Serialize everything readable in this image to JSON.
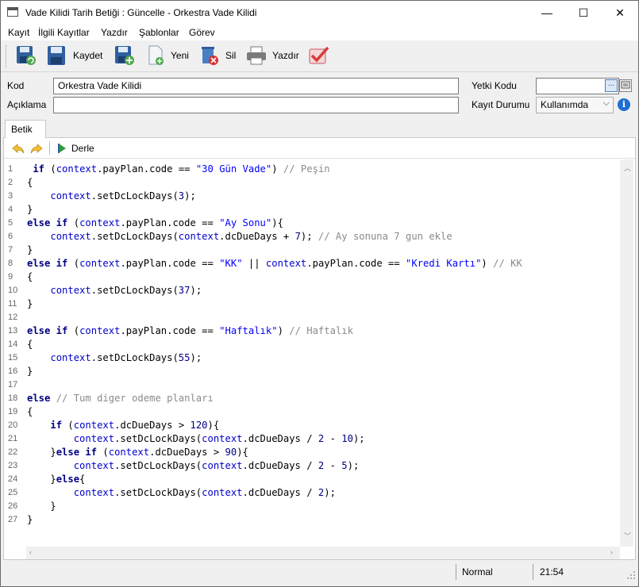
{
  "window": {
    "title": "Vade Kilidi Tarih Betiği : Güncelle - Orkestra Vade Kilidi",
    "minimize_glyph": "—",
    "maximize_glyph": "☐",
    "close_glyph": "✕"
  },
  "menu": [
    "Kayıt",
    "İlgili Kayıtlar",
    "Yazdır",
    "Şablonlar",
    "Görev"
  ],
  "toolbar": {
    "save_label": "Kaydet",
    "new_label": "Yeni",
    "delete_label": "Sil",
    "print_label": "Yazdır",
    "icons": [
      "save-reload-icon",
      "save-icon",
      "save-new-icon",
      "new-document-icon",
      "delete-icon",
      "printer-icon",
      "check-icon"
    ]
  },
  "form": {
    "code_label": "Kod",
    "code_value": "Orkestra Vade Kilidi",
    "description_label": "Açıklama",
    "description_value": "",
    "auth_code_label": "Yetki Kodu",
    "auth_code_value": "",
    "browse_glyph": "...",
    "status_label": "Kayıt Durumu",
    "status_value": "Kullanımda",
    "info_glyph": "i"
  },
  "tabs": [
    {
      "label": "Betik"
    }
  ],
  "editor_toolbar": {
    "compile_label": "Derle"
  },
  "code_lines": [
    [
      {
        "t": " "
      },
      {
        "t": "if",
        "c": "kw"
      },
      {
        "t": " ("
      },
      {
        "t": "context",
        "c": "obj"
      },
      {
        "t": ".payPlan.code == "
      },
      {
        "t": "\"30 Gün Vade\"",
        "c": "str"
      },
      {
        "t": ") "
      },
      {
        "t": "// Peşin",
        "c": "cmt"
      }
    ],
    [
      {
        "t": "{"
      }
    ],
    [
      {
        "t": "    "
      },
      {
        "t": "context",
        "c": "obj"
      },
      {
        "t": ".setDcLockDays("
      },
      {
        "t": "3",
        "c": "num"
      },
      {
        "t": ");"
      }
    ],
    [
      {
        "t": "}"
      }
    ],
    [
      {
        "t": "else if",
        "c": "kw"
      },
      {
        "t": " ("
      },
      {
        "t": "context",
        "c": "obj"
      },
      {
        "t": ".payPlan.code == "
      },
      {
        "t": "\"Ay Sonu\"",
        "c": "str"
      },
      {
        "t": "){"
      }
    ],
    [
      {
        "t": "    "
      },
      {
        "t": "context",
        "c": "obj"
      },
      {
        "t": ".setDcLockDays("
      },
      {
        "t": "context",
        "c": "obj"
      },
      {
        "t": ".dcDueDays + "
      },
      {
        "t": "7",
        "c": "num"
      },
      {
        "t": "); "
      },
      {
        "t": "// Ay sonuna 7 gun ekle",
        "c": "cmt"
      }
    ],
    [
      {
        "t": "}"
      }
    ],
    [
      {
        "t": "else if",
        "c": "kw"
      },
      {
        "t": " ("
      },
      {
        "t": "context",
        "c": "obj"
      },
      {
        "t": ".payPlan.code == "
      },
      {
        "t": "\"KK\"",
        "c": "str"
      },
      {
        "t": " || "
      },
      {
        "t": "context",
        "c": "obj"
      },
      {
        "t": ".payPlan.code == "
      },
      {
        "t": "\"Kredi Kartı\"",
        "c": "str"
      },
      {
        "t": ") "
      },
      {
        "t": "// KK",
        "c": "cmt"
      }
    ],
    [
      {
        "t": "{"
      }
    ],
    [
      {
        "t": "    "
      },
      {
        "t": "context",
        "c": "obj"
      },
      {
        "t": ".setDcLockDays("
      },
      {
        "t": "37",
        "c": "num"
      },
      {
        "t": ");"
      }
    ],
    [
      {
        "t": "}"
      }
    ],
    [
      {
        "t": ""
      }
    ],
    [
      {
        "t": "else if",
        "c": "kw"
      },
      {
        "t": " ("
      },
      {
        "t": "context",
        "c": "obj"
      },
      {
        "t": ".payPlan.code == "
      },
      {
        "t": "\"Haftalık\"",
        "c": "str"
      },
      {
        "t": ") "
      },
      {
        "t": "// Haftalık",
        "c": "cmt"
      }
    ],
    [
      {
        "t": "{"
      }
    ],
    [
      {
        "t": "    "
      },
      {
        "t": "context",
        "c": "obj"
      },
      {
        "t": ".setDcLockDays("
      },
      {
        "t": "55",
        "c": "num"
      },
      {
        "t": ");"
      }
    ],
    [
      {
        "t": "}"
      }
    ],
    [
      {
        "t": ""
      }
    ],
    [
      {
        "t": "else",
        "c": "kw"
      },
      {
        "t": " "
      },
      {
        "t": "// Tum diger odeme planları",
        "c": "cmt"
      }
    ],
    [
      {
        "t": "{"
      }
    ],
    [
      {
        "t": "    "
      },
      {
        "t": "if",
        "c": "kw"
      },
      {
        "t": " ("
      },
      {
        "t": "context",
        "c": "obj"
      },
      {
        "t": ".dcDueDays > "
      },
      {
        "t": "120",
        "c": "num"
      },
      {
        "t": "){"
      }
    ],
    [
      {
        "t": "        "
      },
      {
        "t": "context",
        "c": "obj"
      },
      {
        "t": ".setDcLockDays("
      },
      {
        "t": "context",
        "c": "obj"
      },
      {
        "t": ".dcDueDays / "
      },
      {
        "t": "2",
        "c": "num"
      },
      {
        "t": " - "
      },
      {
        "t": "10",
        "c": "num"
      },
      {
        "t": ");"
      }
    ],
    [
      {
        "t": "    }"
      },
      {
        "t": "else if",
        "c": "kw"
      },
      {
        "t": " ("
      },
      {
        "t": "context",
        "c": "obj"
      },
      {
        "t": ".dcDueDays > "
      },
      {
        "t": "90",
        "c": "num"
      },
      {
        "t": "){"
      }
    ],
    [
      {
        "t": "        "
      },
      {
        "t": "context",
        "c": "obj"
      },
      {
        "t": ".setDcLockDays("
      },
      {
        "t": "context",
        "c": "obj"
      },
      {
        "t": ".dcDueDays / "
      },
      {
        "t": "2",
        "c": "num"
      },
      {
        "t": " - "
      },
      {
        "t": "5",
        "c": "num"
      },
      {
        "t": ");"
      }
    ],
    [
      {
        "t": "    }"
      },
      {
        "t": "else",
        "c": "kw"
      },
      {
        "t": "{"
      }
    ],
    [
      {
        "t": "        "
      },
      {
        "t": "context",
        "c": "obj"
      },
      {
        "t": ".setDcLockDays("
      },
      {
        "t": "context",
        "c": "obj"
      },
      {
        "t": ".dcDueDays / "
      },
      {
        "t": "2",
        "c": "num"
      },
      {
        "t": ");"
      }
    ],
    [
      {
        "t": "    }"
      }
    ],
    [
      {
        "t": "}"
      }
    ]
  ],
  "statusbar": {
    "mode": "Normal",
    "time": "21:54"
  },
  "colors": {
    "keyword": "#000080",
    "object": "#0000cc",
    "string": "#0000ff",
    "comment": "#8a8a8a"
  }
}
